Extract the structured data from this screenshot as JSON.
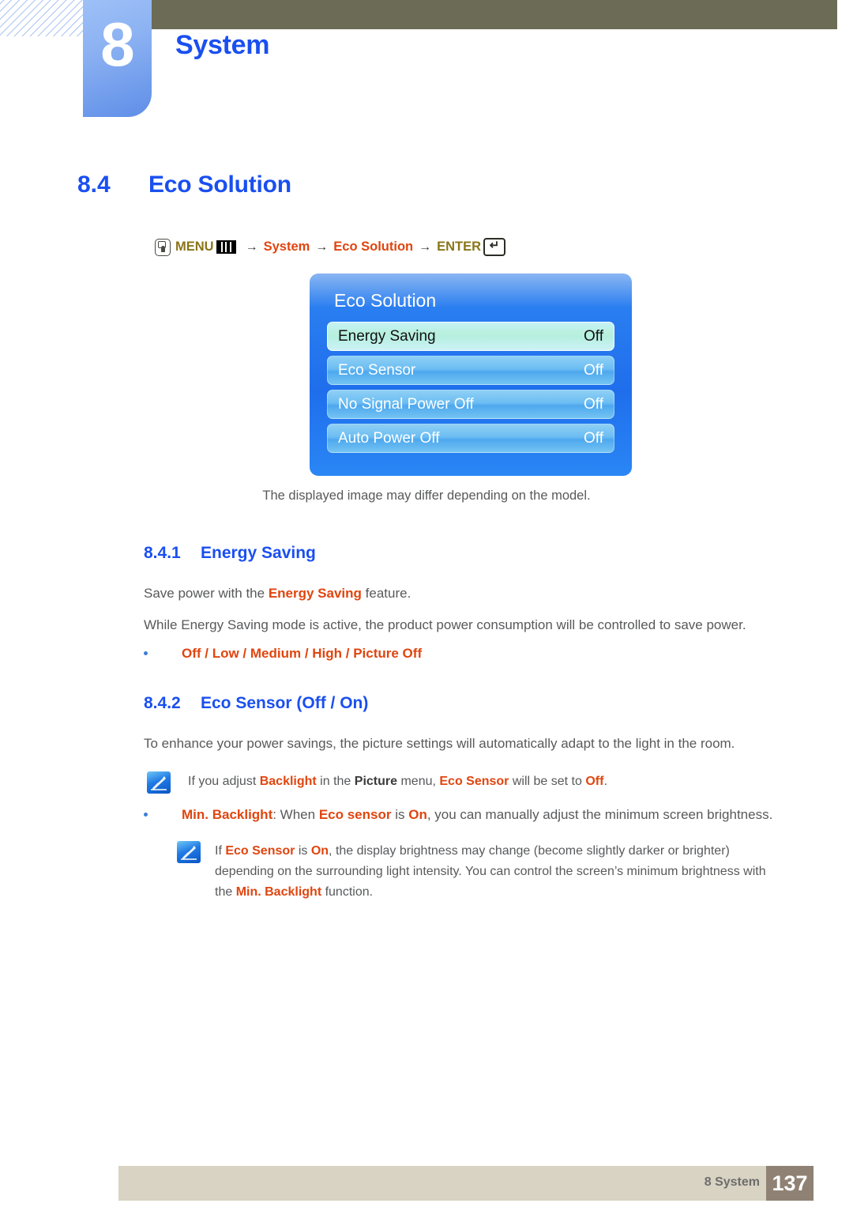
{
  "chapter": {
    "number": "8",
    "title": "System"
  },
  "section": {
    "number": "8.4",
    "title": "Eco Solution"
  },
  "breadcrumb": {
    "remote_icon": "remote-button-press-icon",
    "menu_label": "MENU",
    "menu_icon": "menu-bars-icon",
    "arrow1": "→",
    "node1": "System",
    "arrow2": "→",
    "node2": "Eco Solution",
    "arrow3": "→",
    "enter_label": "ENTER",
    "enter_icon": "enter-key-icon",
    "color_olive": "#8a7519",
    "color_red": "#e0450f"
  },
  "osd": {
    "title": "Eco Solution",
    "rows": [
      {
        "label": "Energy Saving",
        "value": "Off",
        "selected": true
      },
      {
        "label": "Eco Sensor",
        "value": "Off",
        "selected": false
      },
      {
        "label": "No Signal Power Off",
        "value": "Off",
        "selected": false
      },
      {
        "label": "Auto Power Off",
        "value": "Off",
        "selected": false
      }
    ]
  },
  "figure_caption": "The displayed image may differ depending on the model.",
  "subsection1": {
    "number": "8.4.1",
    "title": "Energy Saving",
    "para1_a": "Save power with the ",
    "para1_b": "Energy Saving",
    "para1_c": " feature.",
    "para2": "While Energy Saving mode is active, the product power consumption will be controlled to save power.",
    "options": "Off / Low / Medium / High / Picture Off"
  },
  "subsection2": {
    "number": "8.4.2",
    "title": "Eco Sensor (Off / On)",
    "para1": "To enhance your power savings, the picture settings will automatically adapt to the light in the room.",
    "note1": "If you adjust Backlight in the Picture menu, Eco Sensor will be set to Off.",
    "bullet1": "Min. Backlight: When Eco sensor is On, you can manually adjust the minimum screen brightness.",
    "note2": "If Eco Sensor is On, the display brightness may change (become slightly darker or brighter) depending on the surrounding light intensity. You can control the screen’s minimum brightness with the Min. Backlight function."
  },
  "footer": {
    "label": "8 System",
    "page_number": "137"
  },
  "colors": {
    "chapter_blue": "#1a4ff0",
    "header_olive": "#6c6b55",
    "accent_red": "#e0450f",
    "footer_band": "#d8d3c2",
    "footer_pageno": "#8f8274"
  }
}
